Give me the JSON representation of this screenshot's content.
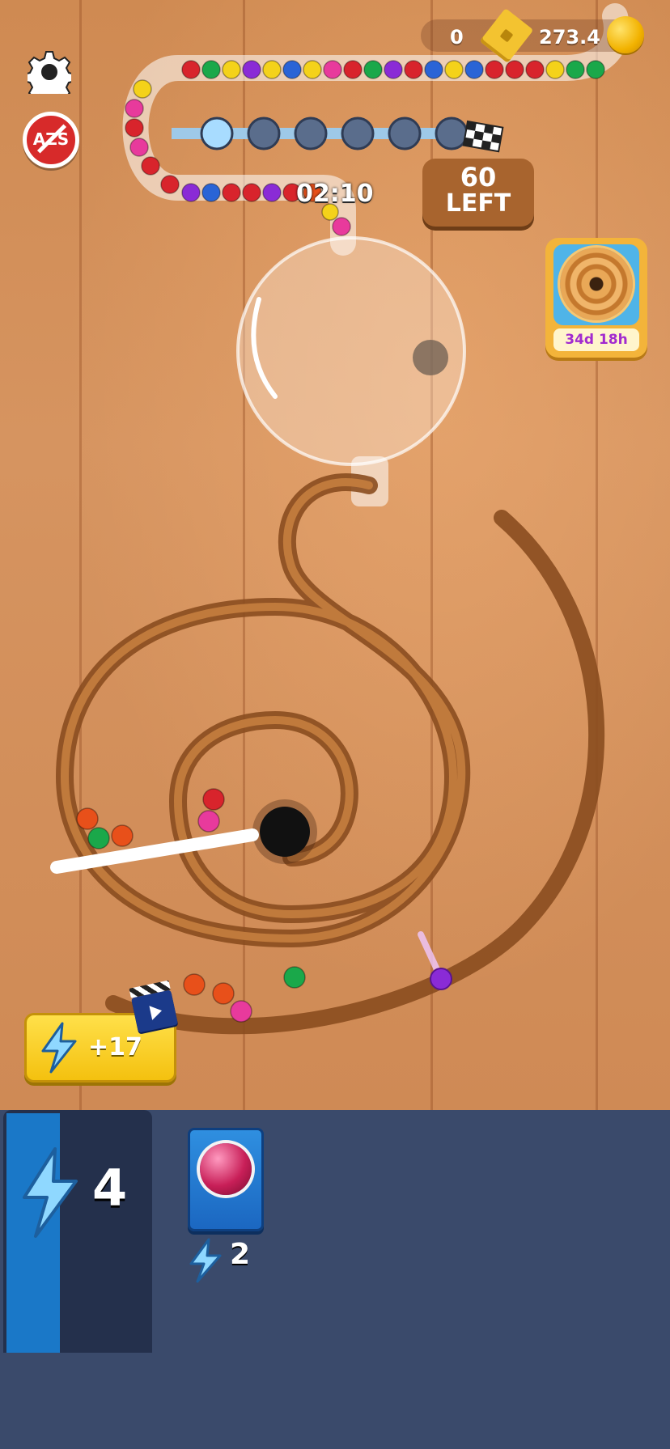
{
  "hud": {
    "tickets": "0",
    "coins": "273.4",
    "timer": "02:10",
    "balls_left_count": "60",
    "balls_left_label": "LEFT",
    "progress": {
      "total_nodes": 6,
      "completed_nodes": 1
    }
  },
  "buttons": {
    "settings_icon": "gear-icon",
    "sort_button_label": "AZS",
    "boost_label": "+17",
    "boost_icon": "lightning-icon",
    "ad_icon": "clapperboard-icon"
  },
  "event": {
    "time_left": "34d 18h",
    "icon": "marble-track-event-icon"
  },
  "bottom": {
    "energy": "4",
    "energy_icon": "lightning-icon",
    "item_cost": "2",
    "item_icon": "pink-marble-icon"
  },
  "colors": {
    "marble_red": "#d8242c",
    "marble_green": "#1aa84a",
    "marble_blue": "#2a64d6",
    "marble_yellow": "#f4d21a",
    "marble_purple": "#8a2bd6",
    "marble_pink": "#e83a9c",
    "marble_orange": "#e8501a",
    "panel_bg": "#3a4a6b",
    "energy_bar": "#1a78c8"
  }
}
